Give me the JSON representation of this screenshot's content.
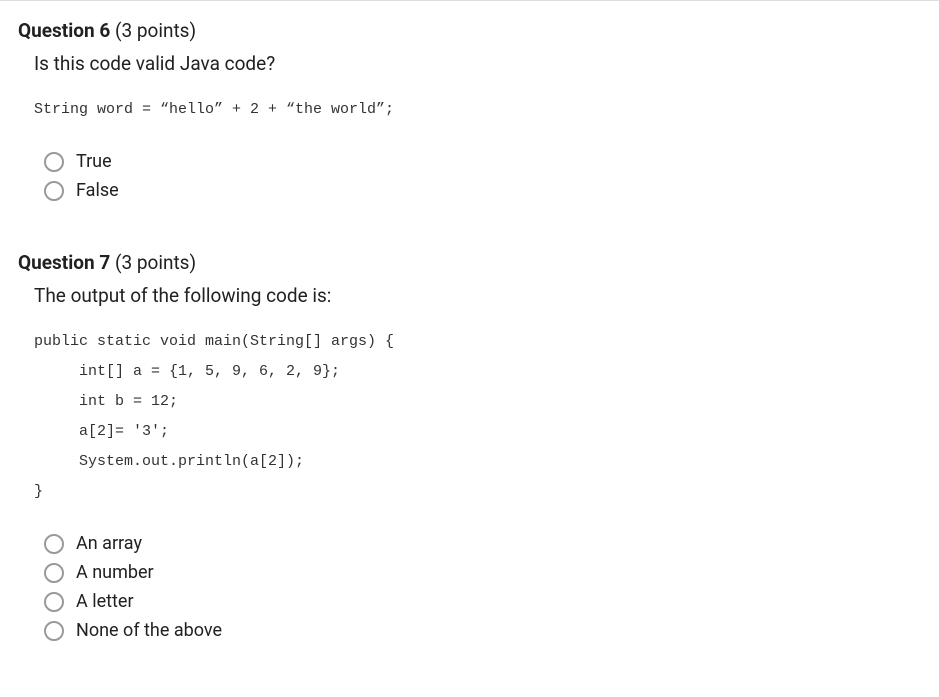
{
  "questions": [
    {
      "number": "Question 6",
      "points": "(3 points)",
      "prompt": "Is this code valid Java code?",
      "code": "String word = “hello” + 2 + “the world”;",
      "options": [
        "True",
        "False"
      ]
    },
    {
      "number": "Question 7",
      "points": "(3 points)",
      "prompt": "The output of the following code is:",
      "code": "public static void main(String[] args) {\n     int[] a = {1, 5, 9, 6, 2, 9};\n     int b = 12;\n     a[2]= '3';\n     System.out.println(a[2]);\n}",
      "options": [
        "An array",
        "A number",
        "A letter",
        "None of the above"
      ]
    }
  ]
}
